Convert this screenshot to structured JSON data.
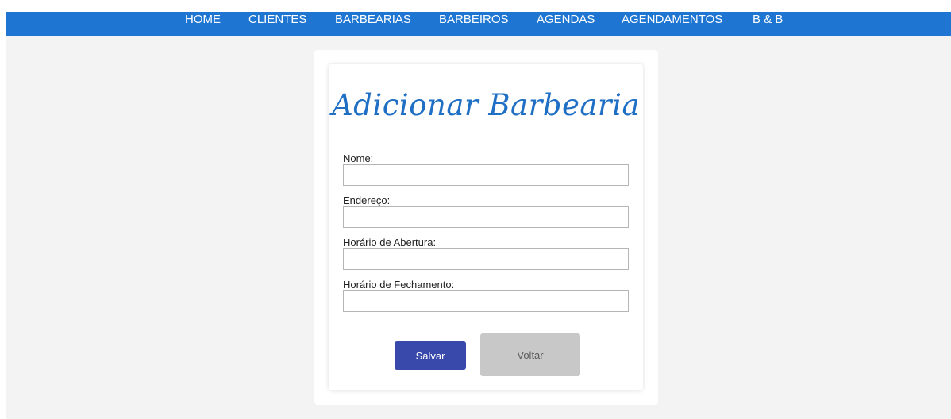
{
  "nav": {
    "items": [
      {
        "label": "HOME"
      },
      {
        "label": "CLIENTES"
      },
      {
        "label": "BARBEARIAS"
      },
      {
        "label": "BARBEIROS"
      },
      {
        "label": "AGENDAS"
      },
      {
        "label": "AGENDAMENTOS"
      },
      {
        "label": "B & B"
      }
    ]
  },
  "form": {
    "title": "Adicionar Barbearia",
    "fields": [
      {
        "label": "Nome:",
        "value": "",
        "placeholder": ""
      },
      {
        "label": "Endereço:",
        "value": "",
        "placeholder": ""
      },
      {
        "label": "Horário de Abertura:",
        "value": "",
        "placeholder": ""
      },
      {
        "label": "Horário de Fechamento:",
        "value": "",
        "placeholder": ""
      }
    ],
    "save_label": "Salvar",
    "back_label": "Voltar"
  },
  "colors": {
    "navbar": "#1f76d2",
    "title": "#1f6fc4",
    "save_button": "#3949ab",
    "back_button": "#c8c8c8",
    "page_background": "#f3f3f3"
  }
}
